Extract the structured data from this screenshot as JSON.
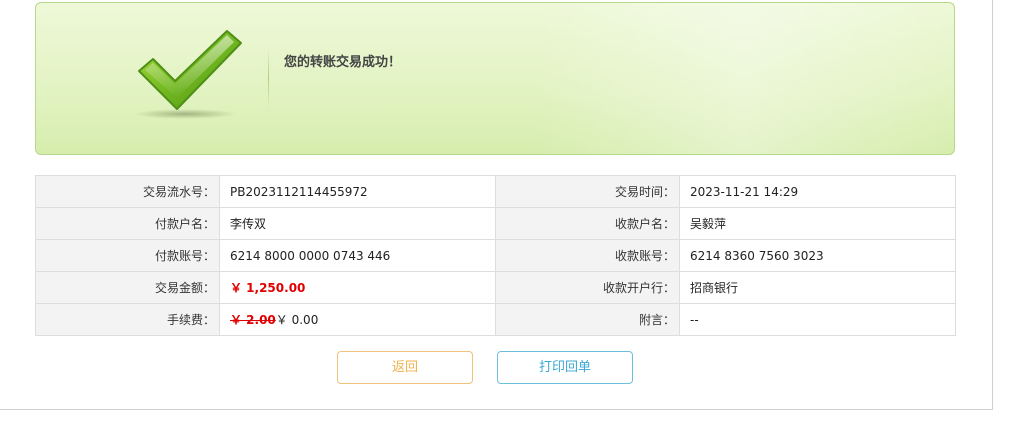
{
  "result": {
    "message": "您的转账交易成功！",
    "icon": "checkmark-icon",
    "accent_color": "#7cc11f"
  },
  "details": {
    "rows": [
      {
        "left_label": "交易流水号：",
        "left_value": "PB2023112114455972",
        "right_label": "交易时间：",
        "right_value": "2023-11-21 14:29"
      },
      {
        "left_label": "付款户名：",
        "left_value": "李传双",
        "right_label": "收款户名：",
        "right_value": "吴毅萍"
      },
      {
        "left_label": "付款账号：",
        "left_value": "6214 8000 0000 0743 446",
        "right_label": "收款账号：",
        "right_value": "6214 8360 7560 3023"
      },
      {
        "left_label": "交易金额：",
        "left_value": "￥ 1,250.00",
        "right_label": "收款开户行：",
        "right_value": "招商银行"
      },
      {
        "left_label": "手续费：",
        "fee_original": "￥ 2.00",
        "fee_actual": "￥ 0.00",
        "right_label": "附言：",
        "right_value": "--"
      }
    ],
    "amount_color": "#e00000"
  },
  "actions": {
    "back_label": "返回",
    "print_label": "打印回单"
  }
}
